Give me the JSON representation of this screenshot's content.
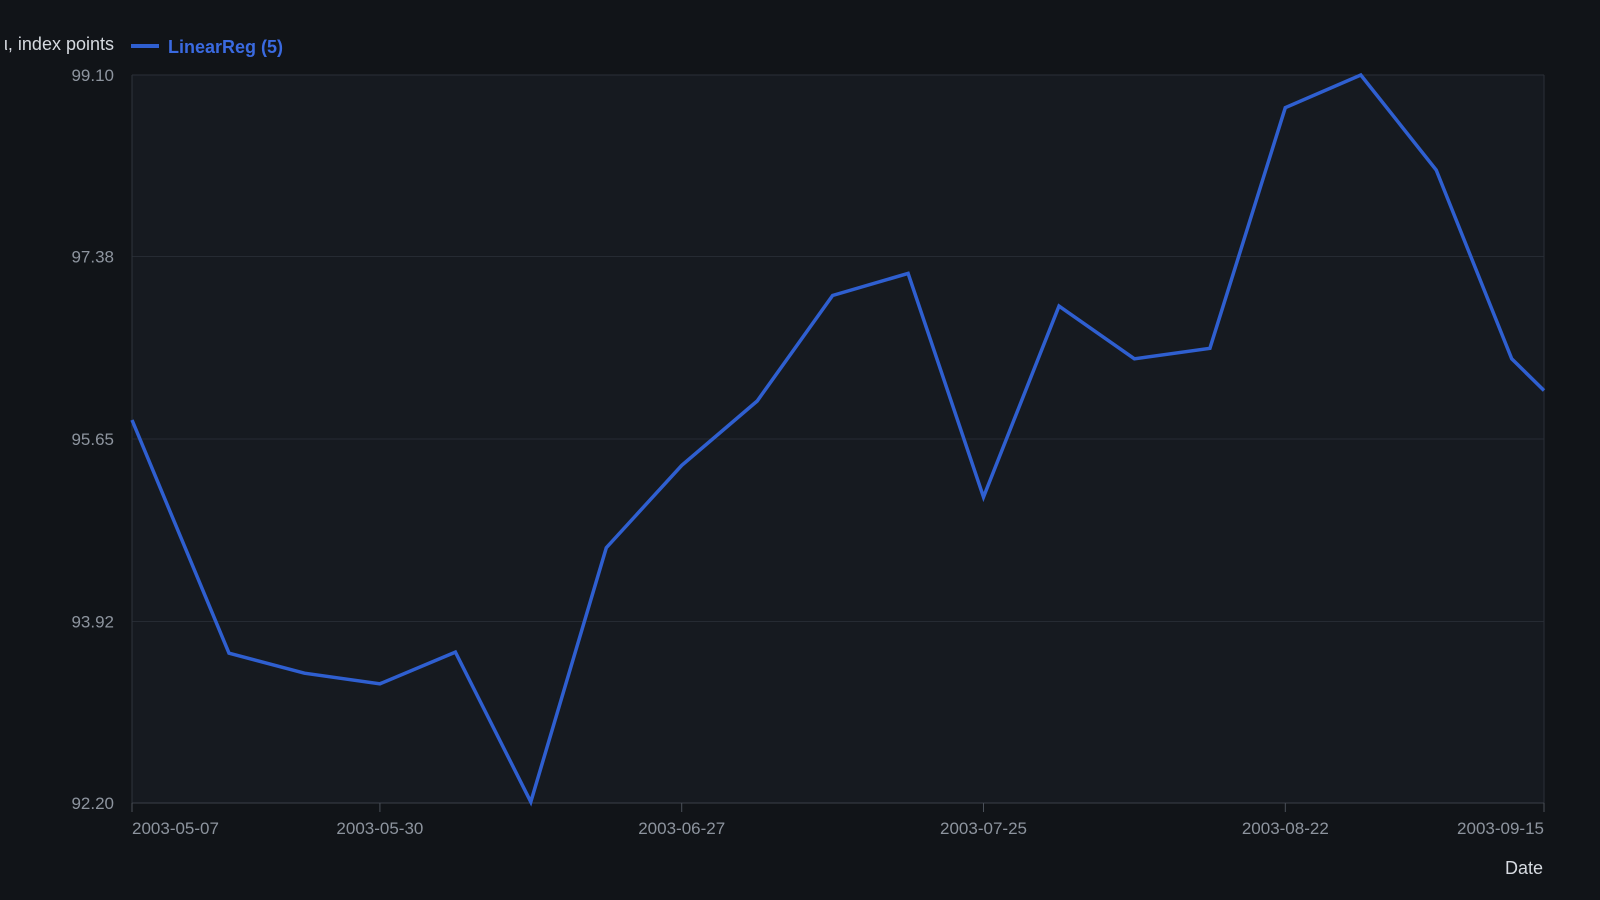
{
  "chart_data": {
    "type": "line",
    "ylabel": "ι, index points",
    "xlabel": "Date",
    "ylim": [
      92.2,
      99.1
    ],
    "y_ticks": [
      "92.20",
      "93.92",
      "95.65",
      "97.38",
      "99.10"
    ],
    "x_ticks": [
      {
        "label": "2003-05-07",
        "date": "2003-05-07"
      },
      {
        "label": "2003-05-30",
        "date": "2003-05-30"
      },
      {
        "label": "2003-06-27",
        "date": "2003-06-27"
      },
      {
        "label": "2003-07-25",
        "date": "2003-07-25"
      },
      {
        "label": "2003-08-22",
        "date": "2003-08-22"
      },
      {
        "label": "2003-09-15",
        "date": "2003-09-15"
      }
    ],
    "xlim": [
      "2003-05-07",
      "2003-09-15"
    ],
    "grid": "horizontal",
    "legend_position": "top-left",
    "series": [
      {
        "name": "LinearReg (5)",
        "color": "#2f5fd0",
        "points": [
          {
            "x": "2003-05-07",
            "y": 95.83
          },
          {
            "x": "2003-05-16",
            "y": 93.62
          },
          {
            "x": "2003-05-23",
            "y": 93.43
          },
          {
            "x": "2003-05-30",
            "y": 93.33
          },
          {
            "x": "2003-06-06",
            "y": 93.63
          },
          {
            "x": "2003-06-13",
            "y": 92.21
          },
          {
            "x": "2003-06-20",
            "y": 94.62
          },
          {
            "x": "2003-06-27",
            "y": 95.4
          },
          {
            "x": "2003-07-04",
            "y": 96.01
          },
          {
            "x": "2003-07-11",
            "y": 97.01
          },
          {
            "x": "2003-07-18",
            "y": 97.22
          },
          {
            "x": "2003-07-25",
            "y": 95.1
          },
          {
            "x": "2003-08-01",
            "y": 96.91
          },
          {
            "x": "2003-08-08",
            "y": 96.41
          },
          {
            "x": "2003-08-15",
            "y": 96.51
          },
          {
            "x": "2003-08-22",
            "y": 98.79
          },
          {
            "x": "2003-08-29",
            "y": 99.1
          },
          {
            "x": "2003-09-05",
            "y": 98.2
          },
          {
            "x": "2003-09-12",
            "y": 96.41
          },
          {
            "x": "2003-09-15",
            "y": 96.11
          }
        ]
      }
    ]
  }
}
